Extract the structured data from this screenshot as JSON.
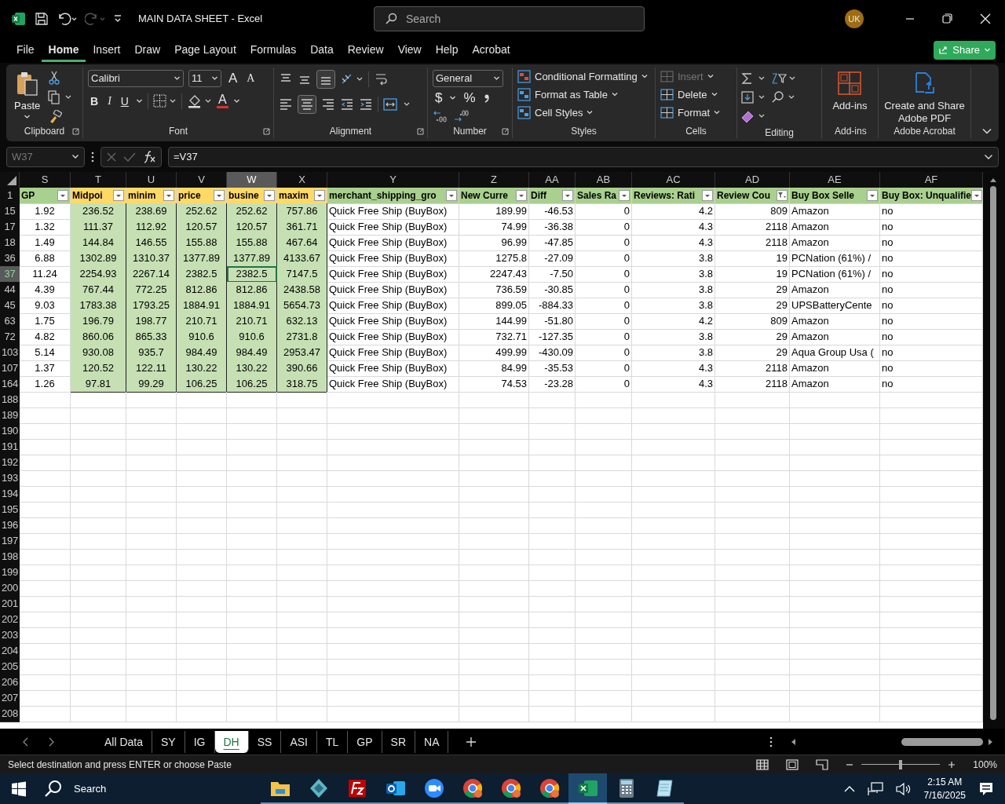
{
  "title_bar": {
    "title": "MAIN DATA SHEET  -  Excel",
    "search_placeholder": "Search",
    "avatar": "UK"
  },
  "menu_tabs": [
    {
      "label": "File",
      "selected": false
    },
    {
      "label": "Home",
      "selected": true
    },
    {
      "label": "Insert",
      "selected": false
    },
    {
      "label": "Draw",
      "selected": false
    },
    {
      "label": "Page Layout",
      "selected": false
    },
    {
      "label": "Formulas",
      "selected": false
    },
    {
      "label": "Data",
      "selected": false
    },
    {
      "label": "Review",
      "selected": false
    },
    {
      "label": "View",
      "selected": false
    },
    {
      "label": "Help",
      "selected": false
    },
    {
      "label": "Acrobat",
      "selected": false
    }
  ],
  "share_button": "Share",
  "ribbon": {
    "clipboard": {
      "paste": "Paste",
      "label": "Clipboard"
    },
    "font": {
      "name": "Calibri",
      "size": "11",
      "grow": "A",
      "shrink": "A",
      "bold": "B",
      "italic": "I",
      "underline": "U",
      "color_letter": "A",
      "label": "Font"
    },
    "alignment": {
      "label": "Alignment"
    },
    "number": {
      "format": "General",
      "currency": "$",
      "percent": "%",
      "label": "Number"
    },
    "styles": {
      "items": [
        "Conditional Formatting",
        "Format as Table",
        "Cell Styles"
      ],
      "label": "Styles"
    },
    "cells": {
      "items": [
        {
          "label": "Insert",
          "disabled": true
        },
        {
          "label": "Delete",
          "disabled": false
        },
        {
          "label": "Format",
          "disabled": false
        }
      ],
      "label": "Cells"
    },
    "editing": {
      "label": "Editing"
    },
    "addins": {
      "button": "Add-ins",
      "label": "Add-ins"
    },
    "acrobat": {
      "button": "Create and Share Adobe PDF",
      "label": "Adobe Acrobat"
    }
  },
  "formula_bar": {
    "name_box": "W37",
    "formula": "=V37"
  },
  "sheet": {
    "header_row": "1",
    "columns": [
      {
        "letter": "S",
        "header": "GP",
        "color": "#a9d08e",
        "shaded": false,
        "kind": "centered",
        "filtered": false,
        "selected": false
      },
      {
        "letter": "T",
        "header": "Midpoi",
        "color": "#ffd966",
        "shaded": true,
        "kind": "centered",
        "filtered": false,
        "selected": false
      },
      {
        "letter": "U",
        "header": "minim",
        "color": "#ffd966",
        "shaded": true,
        "kind": "centered",
        "filtered": false,
        "selected": false
      },
      {
        "letter": "V",
        "header": "price",
        "color": "#ffd966",
        "shaded": true,
        "kind": "centered",
        "filtered": false,
        "selected": false
      },
      {
        "letter": "W",
        "header": "busine",
        "color": "#ffd966",
        "shaded": true,
        "kind": "centered",
        "filtered": false,
        "selected": true
      },
      {
        "letter": "X",
        "header": "maxim",
        "color": "#ffd966",
        "shaded": true,
        "kind": "centered",
        "filtered": false,
        "selected": false
      },
      {
        "letter": "Y",
        "header": "merchant_shipping_gro",
        "color": "#a9d08e",
        "shaded": false,
        "kind": "text",
        "filtered": false,
        "selected": false
      },
      {
        "letter": "Z",
        "header": "New Curre",
        "color": "#a9d08e",
        "shaded": false,
        "kind": "number",
        "filtered": false,
        "selected": false
      },
      {
        "letter": "AA",
        "header": "Diff",
        "color": "#a9d08e",
        "shaded": false,
        "kind": "number",
        "filtered": false,
        "selected": false
      },
      {
        "letter": "AB",
        "header": "Sales Ra",
        "color": "#a9d08e",
        "shaded": false,
        "kind": "number",
        "filtered": false,
        "selected": false
      },
      {
        "letter": "AC",
        "header": "Reviews: Rati",
        "color": "#a9d08e",
        "shaded": false,
        "kind": "number",
        "filtered": false,
        "selected": false
      },
      {
        "letter": "AD",
        "header": "Review Cou",
        "color": "#a9d08e",
        "shaded": false,
        "kind": "number",
        "filtered": true,
        "selected": false
      },
      {
        "letter": "AE",
        "header": "Buy Box Selle",
        "color": "#a9d08e",
        "shaded": false,
        "kind": "text",
        "filtered": false,
        "selected": false
      },
      {
        "letter": "AF",
        "header": "Buy Box: Unqualifie",
        "color": "#a9d08e",
        "shaded": false,
        "kind": "text",
        "filtered": false,
        "selected": false
      }
    ],
    "rows": [
      {
        "number": "15",
        "selected": false,
        "cells": [
          "1.92",
          "236.52",
          "238.69",
          "252.62",
          "252.62",
          "757.86",
          "Quick Free Ship (BuyBox)",
          "189.99",
          "-46.53",
          "0",
          "4.2",
          "809",
          "Amazon",
          "no"
        ]
      },
      {
        "number": "17",
        "selected": false,
        "cells": [
          "1.32",
          "111.37",
          "112.92",
          "120.57",
          "120.57",
          "361.71",
          "Quick Free Ship (BuyBox)",
          "74.99",
          "-36.38",
          "0",
          "4.3",
          "2118",
          "Amazon",
          "no"
        ]
      },
      {
        "number": "18",
        "selected": false,
        "cells": [
          "1.49",
          "144.84",
          "146.55",
          "155.88",
          "155.88",
          "467.64",
          "Quick Free Ship (BuyBox)",
          "96.99",
          "-47.85",
          "0",
          "4.3",
          "2118",
          "Amazon",
          "no"
        ]
      },
      {
        "number": "36",
        "selected": false,
        "cells": [
          "6.88",
          "1302.89",
          "1310.37",
          "1377.89",
          "1377.89",
          "4133.67",
          "Quick Free Ship (BuyBox)",
          "1275.8",
          "-27.09",
          "0",
          "3.8",
          "19",
          "PCNation (61%) /",
          "no"
        ]
      },
      {
        "number": "37",
        "selected": true,
        "cells": [
          "11.24",
          "2254.93",
          "2267.14",
          "2382.5",
          "2382.5",
          "7147.5",
          "Quick Free Ship (BuyBox)",
          "2247.43",
          "-7.50",
          "0",
          "3.8",
          "19",
          "PCNation (61%) /",
          "no"
        ]
      },
      {
        "number": "44",
        "selected": false,
        "cells": [
          "4.39",
          "767.44",
          "772.25",
          "812.86",
          "812.86",
          "2438.58",
          "Quick Free Ship (BuyBox)",
          "736.59",
          "-30.85",
          "0",
          "3.8",
          "29",
          "Amazon",
          "no"
        ]
      },
      {
        "number": "45",
        "selected": false,
        "cells": [
          "9.03",
          "1783.38",
          "1793.25",
          "1884.91",
          "1884.91",
          "5654.73",
          "Quick Free Ship (BuyBox)",
          "899.05",
          "-884.33",
          "0",
          "3.8",
          "29",
          "UPSBatteryCente",
          "no"
        ]
      },
      {
        "number": "63",
        "selected": false,
        "cells": [
          "1.75",
          "196.79",
          "198.77",
          "210.71",
          "210.71",
          "632.13",
          "Quick Free Ship (BuyBox)",
          "144.99",
          "-51.80",
          "0",
          "4.2",
          "809",
          "Amazon",
          "no"
        ]
      },
      {
        "number": "72",
        "selected": false,
        "cells": [
          "4.82",
          "860.06",
          "865.33",
          "910.6",
          "910.6",
          "2731.8",
          "Quick Free Ship (BuyBox)",
          "732.71",
          "-127.35",
          "0",
          "3.8",
          "29",
          "Amazon",
          "no"
        ]
      },
      {
        "number": "103",
        "selected": false,
        "cells": [
          "5.14",
          "930.08",
          "935.7",
          "984.49",
          "984.49",
          "2953.47",
          "Quick Free Ship (BuyBox)",
          "499.99",
          "-430.09",
          "0",
          "3.8",
          "29",
          "Aqua Group Usa (",
          "no"
        ]
      },
      {
        "number": "107",
        "selected": false,
        "cells": [
          "1.37",
          "120.52",
          "122.11",
          "130.22",
          "130.22",
          "390.66",
          "Quick Free Ship (BuyBox)",
          "84.99",
          "-35.53",
          "0",
          "4.3",
          "2118",
          "Amazon",
          "no"
        ]
      },
      {
        "number": "164",
        "selected": false,
        "cells": [
          "1.26",
          "97.81",
          "99.29",
          "106.25",
          "106.25",
          "318.75",
          "Quick Free Ship (BuyBox)",
          "74.53",
          "-23.28",
          "0",
          "4.3",
          "2118",
          "Amazon",
          "no"
        ]
      }
    ],
    "empty_rows": [
      "188",
      "189",
      "190",
      "191",
      "192",
      "193",
      "194",
      "195",
      "196",
      "197",
      "198",
      "199",
      "200",
      "201",
      "202",
      "203",
      "204",
      "205",
      "206",
      "207",
      "208"
    ]
  },
  "sheet_tabs": [
    {
      "label": "All Data",
      "selected": false
    },
    {
      "label": "SY",
      "selected": false
    },
    {
      "label": "IG",
      "selected": false
    },
    {
      "label": "DH",
      "selected": true
    },
    {
      "label": "SS",
      "selected": false
    },
    {
      "label": "ASI",
      "selected": false
    },
    {
      "label": "TL",
      "selected": false
    },
    {
      "label": "GP",
      "selected": false
    },
    {
      "label": "SR",
      "selected": false
    },
    {
      "label": "NA",
      "selected": false
    }
  ],
  "status_bar": {
    "message": "Select destination and press ENTER or choose Paste",
    "zoom": "100%",
    "zoom_slider": {
      "level": 0.5
    }
  },
  "taskbar": {
    "search": "Search",
    "apps": [
      {
        "kind": "folder",
        "active": false
      },
      {
        "kind": "diamond",
        "active": false
      },
      {
        "kind": "ftp",
        "active": false
      },
      {
        "kind": "mail",
        "active": false
      },
      {
        "kind": "video",
        "active": false
      },
      {
        "kind": "browser",
        "active": false
      },
      {
        "kind": "browser",
        "active": false
      },
      {
        "kind": "browser",
        "active": false
      },
      {
        "kind": "spreadsheet",
        "active": true
      },
      {
        "kind": "calculator",
        "active": false
      },
      {
        "kind": "notepad",
        "active": false
      }
    ],
    "time": "2:15 AM",
    "date": "7/16/2025"
  }
}
